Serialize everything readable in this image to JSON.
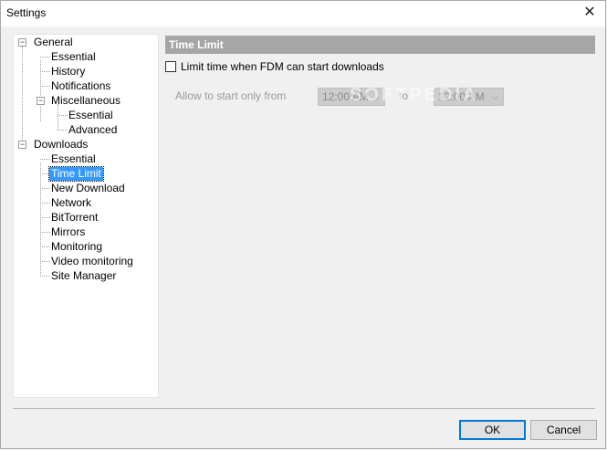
{
  "window": {
    "title": "Settings",
    "close_glyph": "✕"
  },
  "tree": {
    "general": "General",
    "general_essential": "Essential",
    "history": "History",
    "notifications": "Notifications",
    "miscellaneous": "Miscellaneous",
    "misc_essential": "Essential",
    "misc_advanced": "Advanced",
    "downloads": "Downloads",
    "dl_essential": "Essential",
    "time_limit": "Time Limit",
    "new_download": "New Download",
    "network": "Network",
    "bittorrent": "BitTorrent",
    "mirrors": "Mirrors",
    "monitoring": "Monitoring",
    "video_monitoring": "Video monitoring",
    "site_manager": "Site Manager",
    "expander_glyph": "−"
  },
  "panel": {
    "header": "Time Limit",
    "limit_checkbox_label": "Limit time when FDM can start downloads",
    "limit_checked": false,
    "allow_label": "Allow to start only from",
    "from_time": "12:00 AM",
    "to_label": "to",
    "to_time": "12:00 AM",
    "dropdown_glyph": "⌵",
    "watermark": "SOFTPEDIA"
  },
  "buttons": {
    "ok": "OK",
    "cancel": "Cancel"
  }
}
